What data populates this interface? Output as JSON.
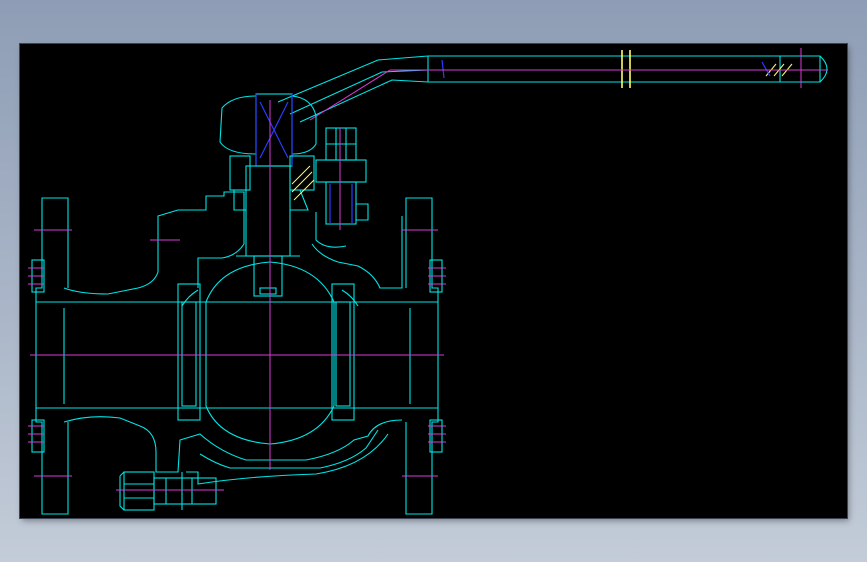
{
  "colors": {
    "canvas": "#000000",
    "outline": "#00e5e5",
    "centerline": "#d93ad9",
    "detail": "#2a3cff",
    "hatch": "#ffff66",
    "desktop": "#9ba8bd"
  },
  "drawing": {
    "subject": "ball-valve-section-view",
    "icons": [
      "handle-lever",
      "stem",
      "ball",
      "valve-body",
      "left-flange",
      "right-flange",
      "bolt-nut",
      "gland-bolt"
    ]
  }
}
